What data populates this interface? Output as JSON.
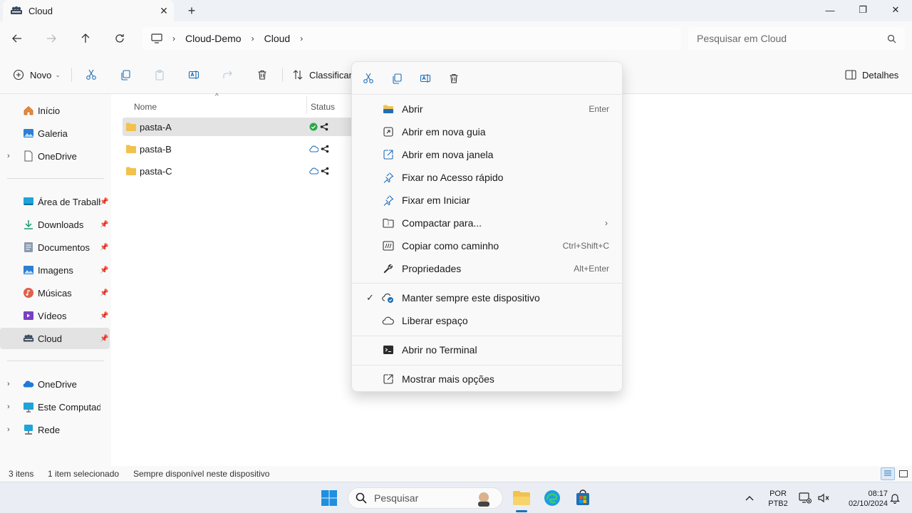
{
  "window": {
    "tab_title": "Cloud",
    "new_tab": "+",
    "controls": {
      "minimize": "—",
      "maximize": "❐",
      "close": "✕"
    }
  },
  "address": {
    "crumbs": [
      "Cloud-Demo",
      "Cloud"
    ],
    "search_placeholder": "Pesquisar em Cloud"
  },
  "commandbar": {
    "new_label": "Novo",
    "sort_label": "Classificar",
    "details_label": "Detalhes"
  },
  "sidebar": {
    "items": [
      {
        "label": "Início",
        "icon": "home-icon"
      },
      {
        "label": "Galeria",
        "icon": "gallery-icon"
      },
      {
        "label": "OneDrive",
        "icon": "document-icon"
      },
      {
        "label": "Área de Trabalho",
        "icon": "desktop-icon"
      },
      {
        "label": "Downloads",
        "icon": "download-icon"
      },
      {
        "label": "Documentos",
        "icon": "documents-icon"
      },
      {
        "label": "Imagens",
        "icon": "pictures-icon"
      },
      {
        "label": "Músicas",
        "icon": "music-icon"
      },
      {
        "label": "Vídeos",
        "icon": "videos-icon"
      },
      {
        "label": "Cloud",
        "icon": "cloud-drive-icon"
      },
      {
        "label": "OneDrive",
        "icon": "onedrive-icon"
      },
      {
        "label": "Este Computador",
        "icon": "computer-icon"
      },
      {
        "label": "Rede",
        "icon": "network-icon"
      }
    ]
  },
  "filelist": {
    "columns": {
      "name": "Nome",
      "status": "Status"
    },
    "rows": [
      {
        "name": "pasta-A",
        "status": "available-locally"
      },
      {
        "name": "pasta-B",
        "status": "cloud-only"
      },
      {
        "name": "pasta-C",
        "status": "cloud-only"
      }
    ]
  },
  "context_menu": {
    "items": [
      {
        "label": "Abrir",
        "shortcut": "Enter"
      },
      {
        "label": "Abrir em nova guia",
        "shortcut": ""
      },
      {
        "label": "Abrir em nova janela",
        "shortcut": ""
      },
      {
        "label": "Fixar no Acesso rápido",
        "shortcut": ""
      },
      {
        "label": "Fixar em Iniciar",
        "shortcut": ""
      },
      {
        "label": "Compactar para...",
        "shortcut": ""
      },
      {
        "label": "Copiar como caminho",
        "shortcut": "Ctrl+Shift+C"
      },
      {
        "label": "Propriedades",
        "shortcut": "Alt+Enter"
      },
      {
        "label": "Manter sempre este dispositivo",
        "shortcut": ""
      },
      {
        "label": "Liberar espaço",
        "shortcut": ""
      },
      {
        "label": "Abrir no Terminal",
        "shortcut": ""
      },
      {
        "label": "Mostrar mais opções",
        "shortcut": ""
      }
    ],
    "check": "✓"
  },
  "statusbar": {
    "count": "3 itens",
    "selected": "1 item selecionado",
    "availability": "Sempre disponível neste dispositivo"
  },
  "taskbar": {
    "search_label": "Pesquisar",
    "lang_line1": "POR",
    "lang_line2": "PTB2",
    "time": "08:17",
    "date": "02/10/2024"
  },
  "colors": {
    "accent": "#1f6fb8",
    "folder": "#f2c14e",
    "synced_green": "#2aa84a"
  }
}
